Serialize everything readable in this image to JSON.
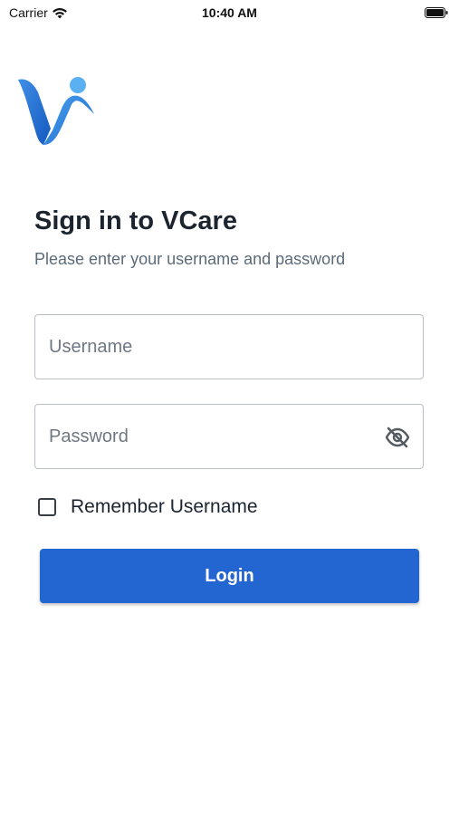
{
  "status_bar": {
    "carrier": "Carrier",
    "time": "10:40 AM",
    "icons": [
      "wifi-icon",
      "battery-icon"
    ]
  },
  "app": {
    "logo": "vcare-logo",
    "brand_colors": {
      "logo_dark_blue": "#1a63c9",
      "logo_light_blue": "#5ab0f0",
      "primary_button": "#2366d1"
    }
  },
  "login": {
    "title": "Sign in to VCare",
    "subtitle": "Please enter your username and password",
    "username": {
      "value": "",
      "placeholder": "Username"
    },
    "password": {
      "value": "",
      "placeholder": "Password",
      "toggle_icon": "eye-off-icon"
    },
    "remember": {
      "label": "Remember Username",
      "checked": false
    },
    "submit_label": "Login"
  }
}
